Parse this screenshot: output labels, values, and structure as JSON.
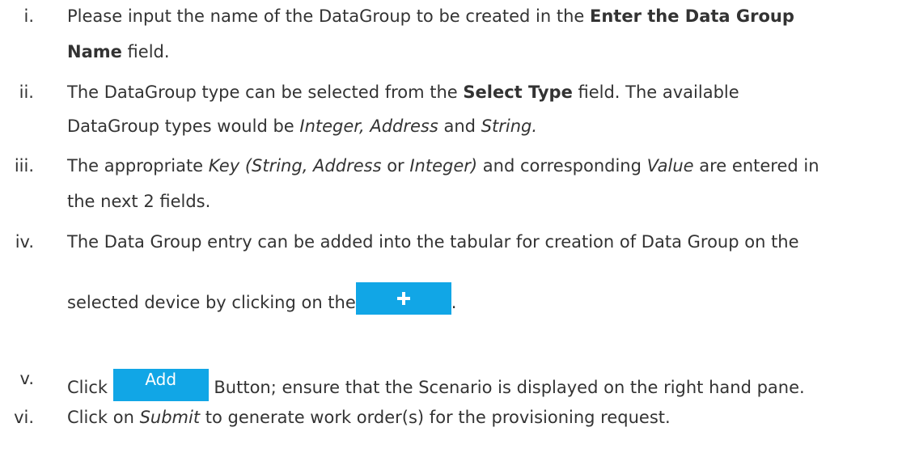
{
  "steps": [
    {
      "marker": "i.",
      "p1": "Please input the name of the DataGroup to be created in the ",
      "b1": "Enter the Data Group",
      "b2": "Name",
      "p2": " field."
    },
    {
      "marker": "ii.",
      "p1": "The DataGroup type can be selected from the ",
      "b1": "Select Type",
      "p2": " field. The available",
      "p3": "DataGroup types would be ",
      "i1": "Integer, Address",
      "p4": " and ",
      "i2": "String."
    },
    {
      "marker": "iii.",
      "p1": "The appropriate ",
      "i1": "Key (String, Address",
      "p2": " or ",
      "i2": "Integer)",
      "p3": " and corresponding ",
      "i3": "Value",
      "p4": " are entered in",
      "p5": "the next 2 fields."
    },
    {
      "marker": "iv.",
      "p1": "The Data Group entry can be added into the tabular for creation of Data Group on the",
      "p2": "selected device by clicking on the",
      "p3": "."
    },
    {
      "marker": "v.",
      "p1": "Click ",
      "button_label": "Add",
      "p2": " Button; ensure that the Scenario is displayed on the right hand pane."
    },
    {
      "marker": "vi.",
      "p1": "Click on ",
      "i1": "Submit",
      "p2": " to generate work order(s) for the provisioning request."
    }
  ],
  "colors": {
    "text": "#333333",
    "button": "#11a6e6",
    "button_text": "#ffffff"
  },
  "icons": {
    "plus_button": "plus-icon"
  }
}
